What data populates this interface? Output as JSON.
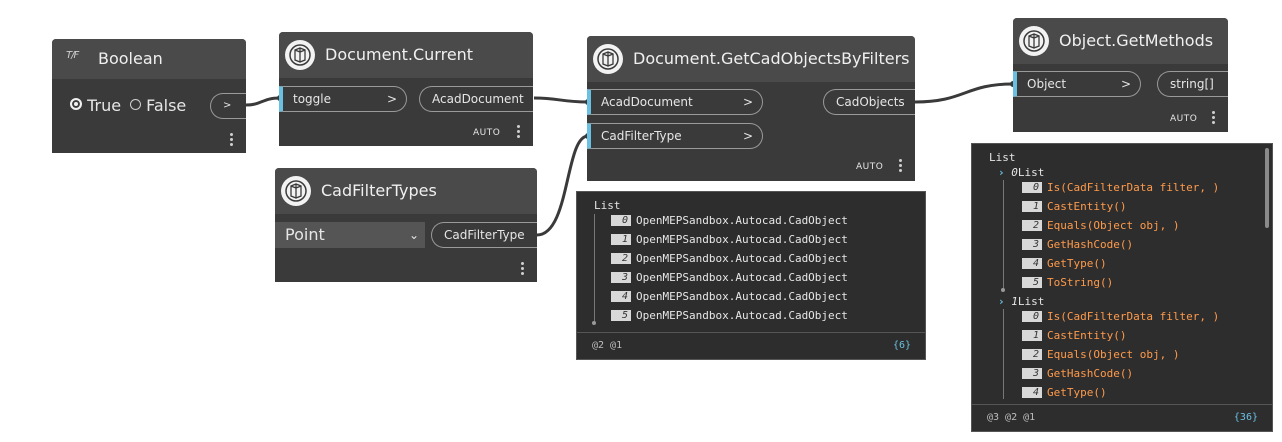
{
  "colors": {
    "node_bg": "#3a3a3a",
    "header_bg": "#4a4a4a",
    "port_accent": "#6ac0e0",
    "preview_bg": "#2d2d2d",
    "list_item_text": "#ff9a4a",
    "count_text": "#6ac0e0"
  },
  "boolean_node": {
    "icon": "boolean-tf-icon",
    "icon_text": "T/F",
    "title": "Boolean",
    "option_true": "True",
    "option_false": "False",
    "selected": "True",
    "output_port": ">"
  },
  "document_current_node": {
    "icon": "dynamo-node-icon",
    "title": "Document.Current",
    "input_port": "toggle",
    "input_chevron": ">",
    "output_port": "AcadDocument",
    "lacing": "AUTO"
  },
  "cad_filter_types_node": {
    "icon": "dynamo-node-icon",
    "title": "CadFilterTypes",
    "dropdown_value": "Point",
    "output_port": "CadFilterType"
  },
  "get_cad_objects_node": {
    "icon": "dynamo-node-icon",
    "title": "Document.GetCadObjectsByFilters",
    "input_ports": [
      "AcadDocument",
      "CadFilterType"
    ],
    "input_chevron": ">",
    "output_port": "CadObjects",
    "lacing": "AUTO"
  },
  "get_cad_objects_preview": {
    "header": "List",
    "items": [
      {
        "index": "0",
        "value": "OpenMEPSandbox.Autocad.CadObject"
      },
      {
        "index": "1",
        "value": "OpenMEPSandbox.Autocad.CadObject"
      },
      {
        "index": "2",
        "value": "OpenMEPSandbox.Autocad.CadObject"
      },
      {
        "index": "3",
        "value": "OpenMEPSandbox.Autocad.CadObject"
      },
      {
        "index": "4",
        "value": "OpenMEPSandbox.Autocad.CadObject"
      },
      {
        "index": "5",
        "value": "OpenMEPSandbox.Autocad.CadObject"
      }
    ],
    "levels": "@2 @1",
    "count": "{6}"
  },
  "get_methods_node": {
    "icon": "dynamo-node-icon",
    "title": "Object.GetMethods",
    "input_port": "Object",
    "input_chevron": ">",
    "output_port": "string[]",
    "lacing": "AUTO"
  },
  "get_methods_preview": {
    "header": "List",
    "sublists": [
      {
        "index": "0",
        "label": "List",
        "items": [
          {
            "index": "0",
            "value": "Is(CadFilterData filter, )"
          },
          {
            "index": "1",
            "value": "CastEntity()"
          },
          {
            "index": "2",
            "value": "Equals(Object obj, )"
          },
          {
            "index": "3",
            "value": "GetHashCode()"
          },
          {
            "index": "4",
            "value": "GetType()"
          },
          {
            "index": "5",
            "value": "ToString()"
          }
        ]
      },
      {
        "index": "1",
        "label": "List",
        "items": [
          {
            "index": "0",
            "value": "Is(CadFilterData filter, )"
          },
          {
            "index": "1",
            "value": "CastEntity()"
          },
          {
            "index": "2",
            "value": "Equals(Object obj, )"
          },
          {
            "index": "3",
            "value": "GetHashCode()"
          },
          {
            "index": "4",
            "value": "GetType()"
          }
        ]
      }
    ],
    "levels": "@3 @2 @1",
    "count": "{36}"
  }
}
